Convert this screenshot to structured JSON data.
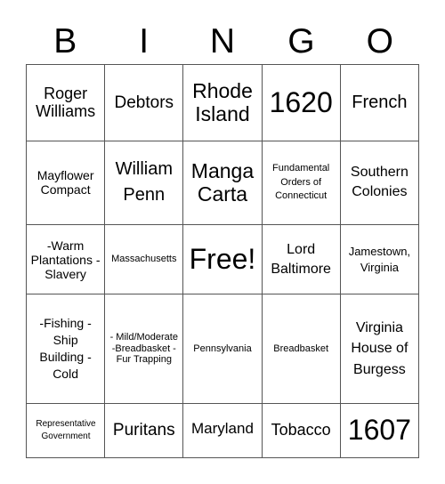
{
  "header": {
    "letters": [
      "B",
      "I",
      "N",
      "G",
      "O"
    ]
  },
  "grid": {
    "rows": [
      [
        "Roger Williams",
        "Debtors",
        "Rhode Island",
        "1620",
        "French"
      ],
      [
        "Mayflower Compact",
        "William Penn",
        "Manga Carta",
        "Fundamental Orders of Connecticut",
        "Southern Colonies"
      ],
      [
        "-Warm Plantations -Slavery",
        "Massachusetts",
        "Free!",
        "Lord Baltimore",
        "Jamestown, Virginia"
      ],
      [
        "-Fishing - Ship Building -Cold",
        "- Mild/Moderate -Breadbasket -Fur Trapping",
        "Pennsylvania",
        "Breadbasket",
        "Virginia House of Burgess"
      ],
      [
        "Representative Government",
        "Puritans",
        "Maryland",
        "Tobacco",
        "1607"
      ]
    ]
  }
}
